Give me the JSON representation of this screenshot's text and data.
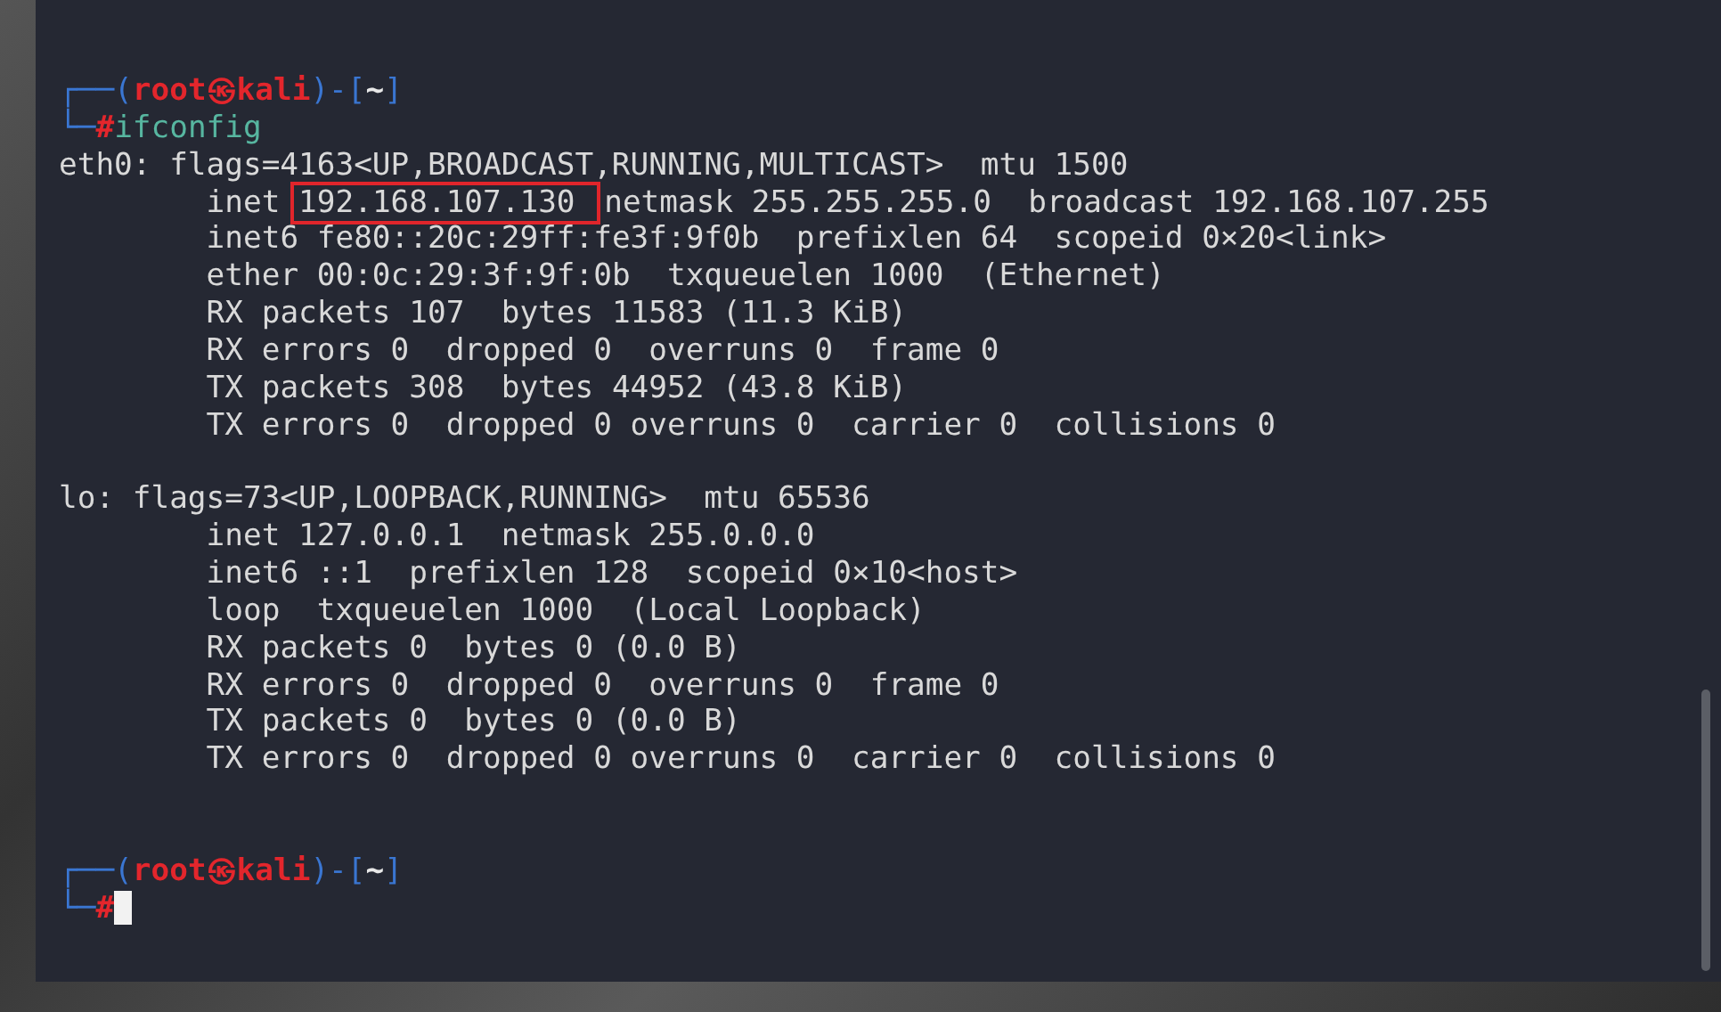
{
  "terminal": {
    "entries": [
      {
        "kind": "prompt",
        "open": "┌──(",
        "user": "root",
        "at": "㉿",
        "host": "kali",
        "mid": ")-[",
        "cwd": "~",
        "close": "]",
        "corner": "└─",
        "symbol": "#",
        "command": "ifconfig",
        "cursor": false
      },
      {
        "kind": "output",
        "lines": [
          {
            "indented": false,
            "segments": [
              {
                "text": "eth0: flags=4163<UP,BROADCAST,RUNNING,MULTICAST>  mtu 1500",
                "highlighted": false
              }
            ]
          },
          {
            "indented": true,
            "segments": [
              {
                "text": "inet",
                "highlighted": false
              },
              {
                "text": "192.168.107.130",
                "highlighted": true
              },
              {
                "text": "netmask 255.255.255.0  broadcast 192.168.107.255",
                "highlighted": false
              }
            ]
          },
          {
            "indented": true,
            "segments": [
              {
                "text": "inet6 fe80::20c:29ff:fe3f:9f0b  prefixlen 64  scopeid 0×20<link>",
                "highlighted": false
              }
            ]
          },
          {
            "indented": true,
            "segments": [
              {
                "text": "ether 00:0c:29:3f:9f:0b  txqueuelen 1000  (Ethernet)",
                "highlighted": false
              }
            ]
          },
          {
            "indented": true,
            "segments": [
              {
                "text": "RX packets 107  bytes 11583 (11.3 KiB)",
                "highlighted": false
              }
            ]
          },
          {
            "indented": true,
            "segments": [
              {
                "text": "RX errors 0  dropped 0  overruns 0  frame 0",
                "highlighted": false
              }
            ]
          },
          {
            "indented": true,
            "segments": [
              {
                "text": "TX packets 308  bytes 44952 (43.8 KiB)",
                "highlighted": false
              }
            ]
          },
          {
            "indented": true,
            "segments": [
              {
                "text": "TX errors 0  dropped 0 overruns 0  carrier 0  collisions 0",
                "highlighted": false
              }
            ]
          }
        ]
      },
      {
        "kind": "output",
        "lines": [
          {
            "indented": false,
            "segments": [
              {
                "text": "lo: flags=73<UP,LOOPBACK,RUNNING>  mtu 65536",
                "highlighted": false
              }
            ]
          },
          {
            "indented": true,
            "segments": [
              {
                "text": "inet 127.0.0.1  netmask 255.0.0.0",
                "highlighted": false
              }
            ]
          },
          {
            "indented": true,
            "segments": [
              {
                "text": "inet6 ::1  prefixlen 128  scopeid 0×10<host>",
                "highlighted": false
              }
            ]
          },
          {
            "indented": true,
            "segments": [
              {
                "text": "loop  txqueuelen 1000  (Local Loopback)",
                "highlighted": false
              }
            ]
          },
          {
            "indented": true,
            "segments": [
              {
                "text": "RX packets 0  bytes 0 (0.0 B)",
                "highlighted": false
              }
            ]
          },
          {
            "indented": true,
            "segments": [
              {
                "text": "RX errors 0  dropped 0  overruns 0  frame 0",
                "highlighted": false
              }
            ]
          },
          {
            "indented": true,
            "segments": [
              {
                "text": "TX packets 0  bytes 0 (0.0 B)",
                "highlighted": false
              }
            ]
          },
          {
            "indented": true,
            "segments": [
              {
                "text": "TX errors 0  dropped 0 overruns 0  carrier 0  collisions 0",
                "highlighted": false
              }
            ]
          }
        ]
      },
      {
        "kind": "prompt",
        "open": "┌──(",
        "user": "root",
        "at": "㉿",
        "host": "kali",
        "mid": ")-[",
        "cwd": "~",
        "close": "]",
        "corner": "└─",
        "symbol": "#",
        "cursor": true
      }
    ]
  }
}
